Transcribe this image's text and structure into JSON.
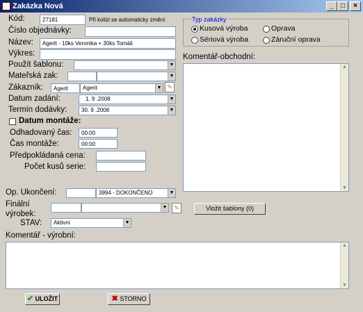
{
  "window": {
    "title": "Zakázka Nová",
    "min": "_",
    "max": "□",
    "close": "×"
  },
  "kod": {
    "label": "Kód:",
    "value": "27181",
    "note": "Při kolizi se automaticky změní"
  },
  "cislo_objednavky": {
    "label": "Číslo objednávky:",
    "value": ""
  },
  "nazev": {
    "label": "Název:",
    "value": "Agerit - 10ks Veronika + 30ks Tomáš"
  },
  "vykres": {
    "label": "Výkres:",
    "value": ""
  },
  "pouzit_sablonu": {
    "label": "Použít šablonu:",
    "value": ""
  },
  "materska_zak": {
    "label": "Mateřská zak:",
    "value1": "",
    "value2": ""
  },
  "zakaznik": {
    "label": "Zákazník:",
    "value1": "Agerit",
    "value2": "Agerit"
  },
  "datum_zadani": {
    "label": "Datum zadání:",
    "value": "1. 9 .2008"
  },
  "termin_dodavky": {
    "label": "Termín dodávky:",
    "value": "30. 9 .2008"
  },
  "datum_montaze": {
    "label": "Datum montáže:",
    "checked": false
  },
  "odhadovany_cas": {
    "label": "Odhadovaný čas:",
    "value": "00:00"
  },
  "cas_montaze": {
    "label": "Čas montáže:",
    "value": "00:00"
  },
  "predpokladana_cena": {
    "label": "Předpokládaná cena:",
    "value": ""
  },
  "pocet_kusu": {
    "label": "Počet kusů serie:",
    "value": ""
  },
  "typ_zakazky": {
    "legend": "Typ zakázky",
    "options": [
      {
        "label": "Kusová výroba",
        "selected": true
      },
      {
        "label": "Oprava",
        "selected": false
      },
      {
        "label": "Sériová výroba",
        "selected": false
      },
      {
        "label": "Záruční oprava",
        "selected": false
      }
    ]
  },
  "komentar_obchodni": {
    "label": "Komentář-obchodní:",
    "value": ""
  },
  "op_ukonceni": {
    "label": "Op. Ukončení:",
    "value1": "",
    "value2": "3994 - DOKONČENO"
  },
  "finalni_vyrobek": {
    "label1": "Finální",
    "label2": "výrobek:",
    "value1": "",
    "value2": ""
  },
  "vlozit_sablony": {
    "label": "Vložit šablony (0)"
  },
  "stav": {
    "label": "STAV:",
    "value": "Aktivní"
  },
  "komentar_vyrobni": {
    "label": "Komentář - výrobní:",
    "value": ""
  },
  "ulozit": {
    "label": "ULOŽIT"
  },
  "storno": {
    "label": "STORNO"
  },
  "colors": {
    "titlebar_start": "#0a246a",
    "titlebar_end": "#a6caf0",
    "legend": "#0000cc",
    "ok_icon": "#2a8a2a",
    "cancel_icon": "#c00000"
  }
}
